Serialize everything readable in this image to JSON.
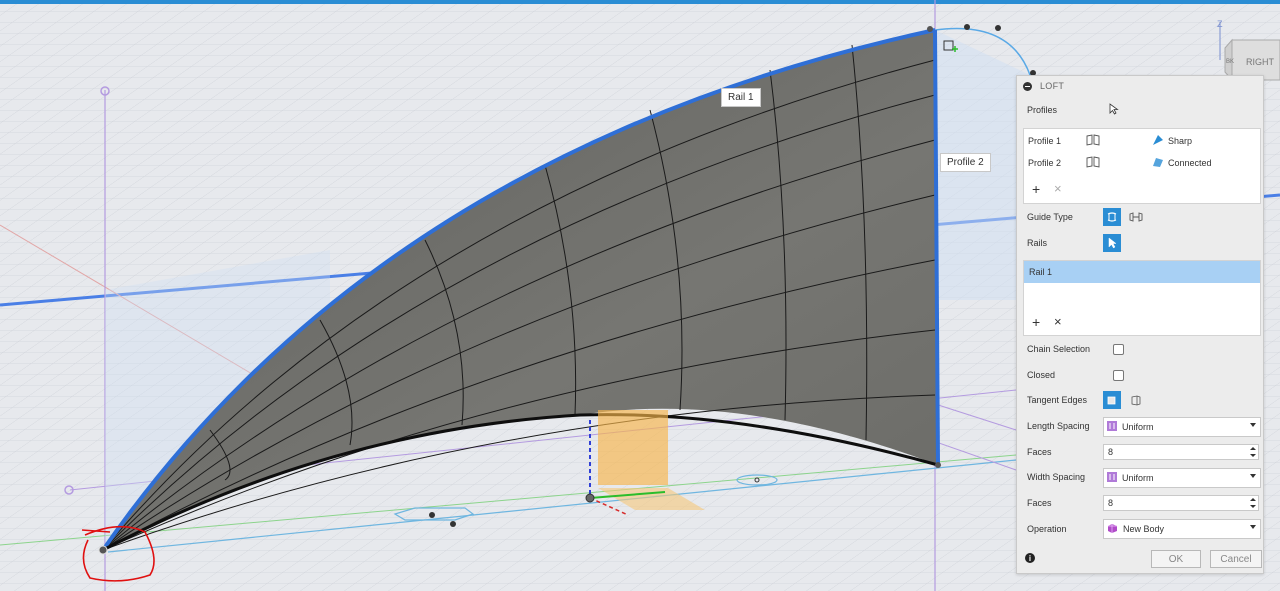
{
  "viewport": {
    "rail_label": "Rail 1",
    "profile2_label": "Profile 2",
    "view_cube": {
      "face": "RIGHT",
      "small": "BK",
      "axis": "Z"
    }
  },
  "loft": {
    "title": "LOFT",
    "profiles_label": "Profiles",
    "profiles": [
      {
        "name": "Profile 1",
        "condition": "Sharp"
      },
      {
        "name": "Profile 2",
        "condition": "Connected"
      }
    ],
    "guide_type_label": "Guide Type",
    "rails_label": "Rails",
    "rails": [
      "Rail 1"
    ],
    "chain_selection_label": "Chain Selection",
    "closed_label": "Closed",
    "tangent_edges_label": "Tangent Edges",
    "length_spacing": {
      "label": "Length Spacing",
      "value": "Uniform"
    },
    "length_faces": {
      "label": "Faces",
      "value": "8"
    },
    "width_spacing": {
      "label": "Width Spacing",
      "value": "Uniform"
    },
    "width_faces": {
      "label": "Faces",
      "value": "8"
    },
    "operation": {
      "label": "Operation",
      "value": "New Body"
    },
    "ok_label": "OK",
    "cancel_label": "Cancel",
    "add_symbol": "+",
    "remove_symbol": "×"
  },
  "colors": {
    "accent": "#2a8dd4",
    "surface": "#6a6a66",
    "edge_highlight": "#2f6fd6",
    "selected_row": "#a8d0f4"
  }
}
